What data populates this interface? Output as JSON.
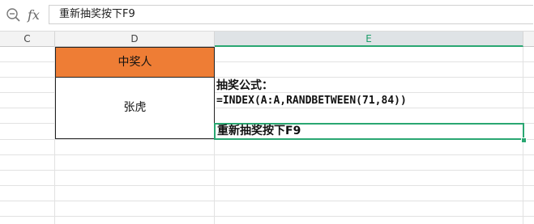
{
  "formula_bar": {
    "zoom_icon": "zoom-magnifier-icon",
    "fx_label": "fx",
    "value": "重新抽奖按下F9"
  },
  "columns": {
    "c": "C",
    "d": "D",
    "e": "E"
  },
  "cells": {
    "d_header": "中奖人",
    "d_winner": "张虎",
    "e_label": "抽奖公式：",
    "e_formula": "=INDEX(A:A,RANDBETWEEN(71,84))",
    "e_active": "重新抽奖按下F9"
  },
  "colors": {
    "header_fill": "#ee7d35",
    "selection": "#2aa772"
  }
}
